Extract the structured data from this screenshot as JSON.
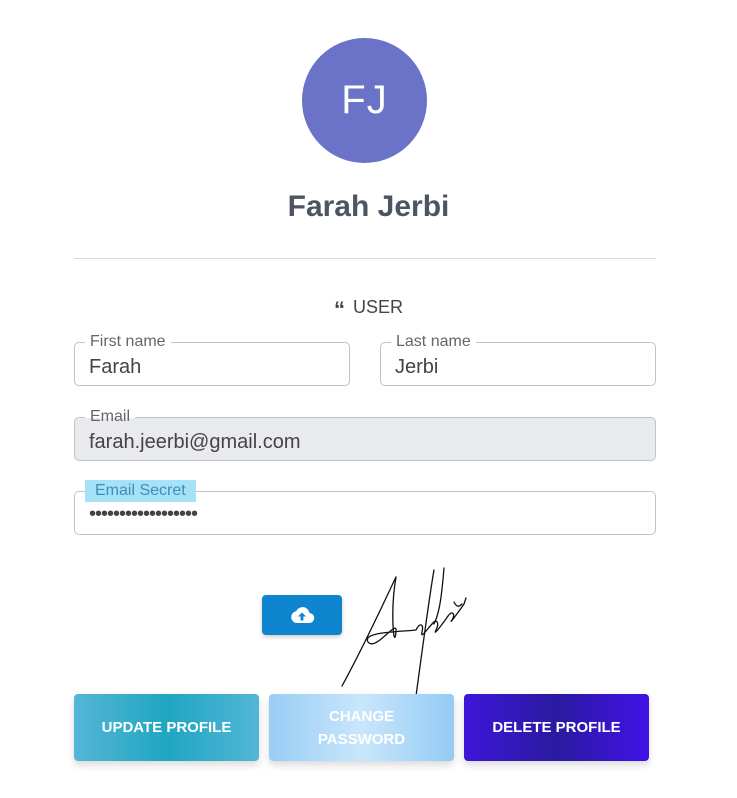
{
  "profile": {
    "initials": "FJ",
    "name": "Farah Jerbi",
    "role": "USER",
    "avatar_color": "#6a73c8"
  },
  "form": {
    "first_name": {
      "label": "First name",
      "value": "Farah"
    },
    "last_name": {
      "label": "Last name",
      "value": "Jerbi"
    },
    "email": {
      "label": "Email",
      "value": "farah.jeerbi@gmail.com"
    },
    "email_secret": {
      "label": "Email Secret",
      "value": "••••••••••••••••••"
    }
  },
  "icons": {
    "role": "quote-icon",
    "upload": "cloud-upload-icon"
  },
  "actions": {
    "update": "UPDATE PROFILE",
    "change_line1": "CHANGE",
    "change_line2": "PASSWORD",
    "delete": "DELETE PROFILE"
  },
  "colors": {
    "upload_button": "#0f84cf",
    "update_button": "#1fa6c1",
    "change_button": "#a8d5f7",
    "delete_button": "#3d16d8"
  }
}
